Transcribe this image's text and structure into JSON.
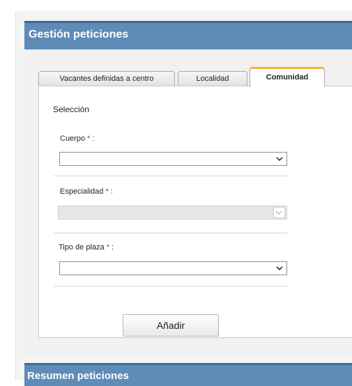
{
  "panel": {
    "title": "Gestión peticiones"
  },
  "tabs": [
    {
      "label": "Vacantes definidas a centro",
      "active": false
    },
    {
      "label": "Localidad",
      "active": false
    },
    {
      "label": "Comunidad",
      "active": true
    }
  ],
  "form": {
    "section_title": "Selección",
    "required_marker": "*",
    "fields": [
      {
        "label": "Cuerpo",
        "suffix": ":",
        "value": "",
        "disabled": false
      },
      {
        "label": "Especialidad",
        "suffix": ":",
        "value": "",
        "disabled": true
      },
      {
        "label": "Tipo de plaza",
        "suffix": ":",
        "value": "",
        "disabled": false
      }
    ],
    "add_button_label": "Añadir"
  },
  "summary": {
    "title": "Resumen peticiones"
  },
  "icons": {
    "dropdown": "chevron-down-icon"
  },
  "colors": {
    "header_bg": "#5f8bb8",
    "active_tab_accent": "#f3b23a",
    "required": "#d0202a"
  }
}
